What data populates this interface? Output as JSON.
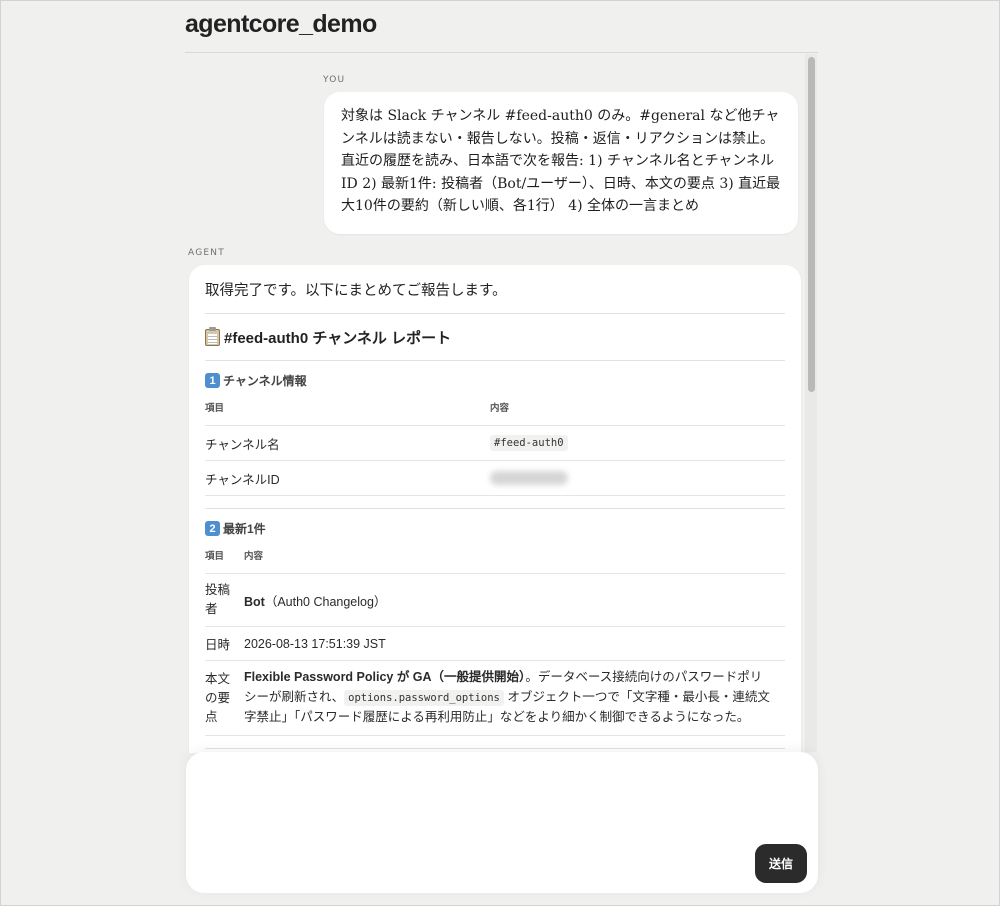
{
  "app": {
    "title": "agentcore_demo"
  },
  "messages": {
    "user": {
      "role_label": "YOU",
      "text": "対象は Slack チャンネル #feed-auth0 のみ。#general など他チャンネルは読まない・報告しない。投稿・返信・リアクションは禁止。直近の履歴を読み、日本語で次を報告: 1) チャンネル名とチャンネルID 2) 最新1件: 投稿者（Bot/ユーザー）、日時、本文の要点 3) 直近最大10件の要約（新しい順、各1行） 4) 全体の一言まとめ"
    },
    "agent": {
      "role_label": "AGENT",
      "intro": "取得完了です。以下にまとめてご報告します。",
      "report_title": "#feed-auth0 チャンネル レポート",
      "section1": {
        "number": "1",
        "title": "チャンネル情報",
        "col_item": "項目",
        "col_content": "内容",
        "rows": [
          {
            "label": "チャンネル名",
            "value": "#feed-auth0"
          },
          {
            "label": "チャンネルID",
            "value": ""
          }
        ]
      },
      "section2": {
        "number": "2",
        "title": "最新1件",
        "col_item": "項目",
        "col_content": "内容",
        "poster_label": "投稿者",
        "poster_bold": "Bot",
        "poster_rest": "（Auth0 Changelog）",
        "datetime_label": "日時",
        "datetime_value": "2026-08-13 17:51:39 JST",
        "body_label": "本文の要点",
        "body_bold": "Flexible Password Policy が GA（一般提供開始）",
        "body_text1": "。データベース接続向けのパスワードポリシーが刷新され、",
        "body_code": "options.password_options",
        "body_text2": " オブジェクト一つで「文字種・最小長・連続文字禁止」「パスワード履歴による再利用防止」などをより細かく制御できるようになった。"
      }
    }
  },
  "composer": {
    "placeholder": "",
    "send_label": "送信"
  },
  "icons": {
    "report": "clipboard-icon",
    "section_number": "keycap-number-icon"
  }
}
